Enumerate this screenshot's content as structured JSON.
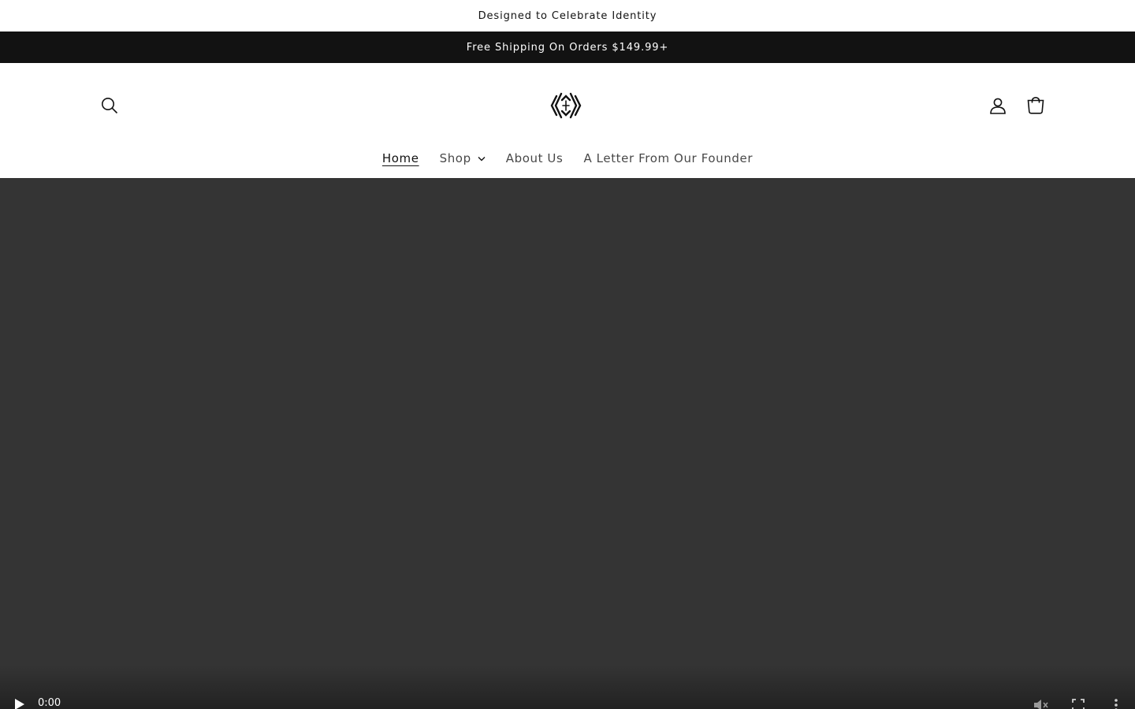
{
  "announcements": {
    "top": "Designed to Celebrate Identity",
    "bar": "Free Shipping On Orders $149.99+"
  },
  "header": {
    "icons": {
      "search": "search-icon",
      "logo": "brand-logo",
      "account": "account-icon",
      "cart": "cart-icon"
    }
  },
  "nav": {
    "items": [
      {
        "label": "Home",
        "active": true
      },
      {
        "label": "Shop",
        "has_dropdown": true
      },
      {
        "label": "About Us"
      },
      {
        "label": "A Letter From Our Founder"
      }
    ]
  },
  "video": {
    "time": "0:00",
    "icons": [
      "play-icon",
      "muted-volume-icon",
      "fullscreen-icon",
      "more-options-icon"
    ]
  },
  "colors": {
    "announcement_bar": "#121212",
    "video_background": "#343434",
    "text": "#121212"
  }
}
